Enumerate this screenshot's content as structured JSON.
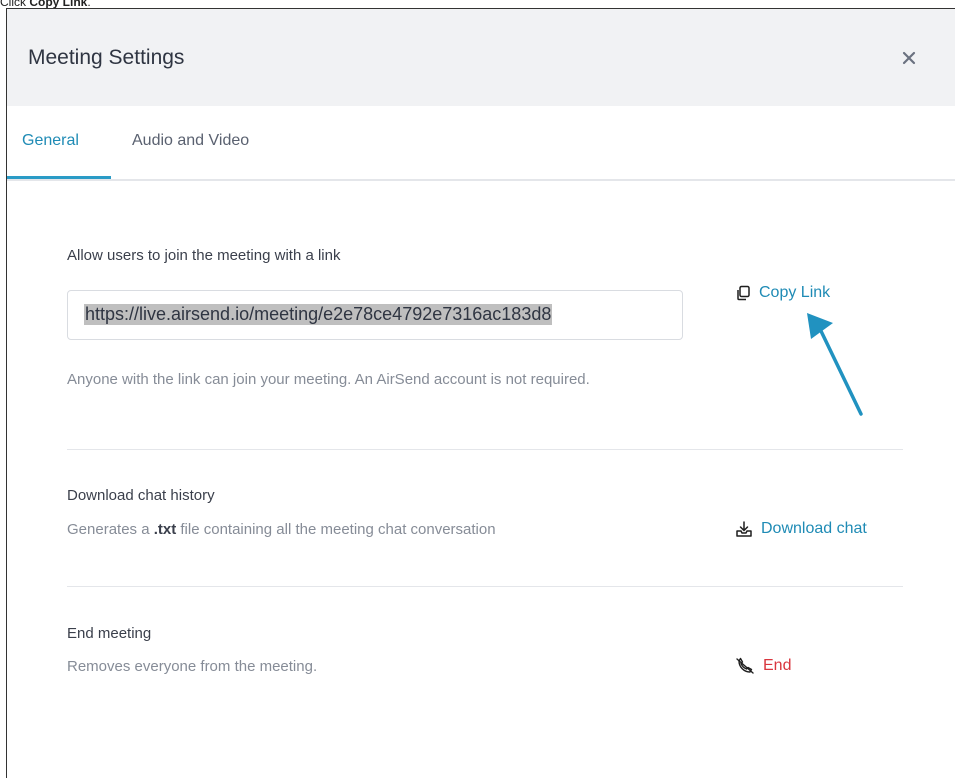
{
  "caption": {
    "prefix": "Click ",
    "bold": "Copy Link",
    "suffix": "."
  },
  "dialog": {
    "title": "Meeting Settings",
    "close_label": "×"
  },
  "tabs": [
    {
      "label": "General",
      "active": true
    },
    {
      "label": "Audio and Video",
      "active": false
    }
  ],
  "link_section": {
    "title": "Allow users to join the meeting with a link",
    "url": "https://live.airsend.io/meeting/e2e78ce4792e7316ac183d8",
    "copy_label": "Copy Link",
    "description": "Anyone with the link can join your meeting. An AirSend account is not required."
  },
  "chat_section": {
    "title": "Download chat history",
    "desc_prefix": "Generates a ",
    "desc_bold": ".txt",
    "desc_suffix": " file containing all the meeting chat conversation",
    "action_label": "Download chat"
  },
  "end_section": {
    "title": "End meeting",
    "description": "Removes everyone from the meeting.",
    "action_label": "End"
  },
  "colors": {
    "accent": "#1f8bb5",
    "danger": "#d9363e",
    "arrow": "#2192c0"
  },
  "icons": {
    "copy": "copy-icon",
    "download": "download-icon",
    "end_call": "end-call-icon",
    "close": "close-icon"
  }
}
